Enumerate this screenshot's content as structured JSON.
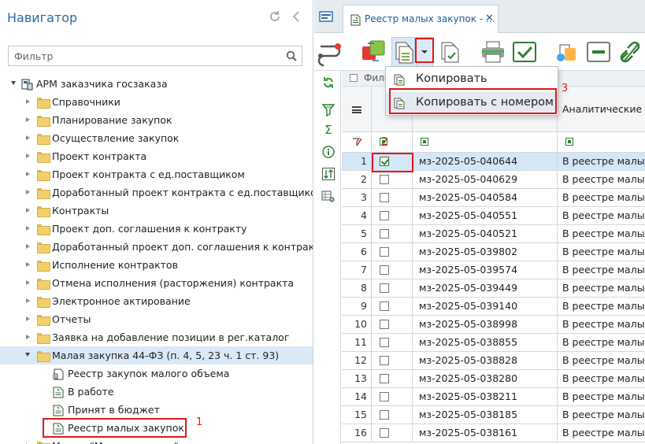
{
  "navigator": {
    "title": "Навигатор",
    "filter_placeholder": "Фильтр",
    "root": "АРМ заказчика госзаказа",
    "items": [
      "Справочники",
      "Планирование закупок",
      "Осуществление закупок",
      "Проект контракта",
      "Проект контракта с ед.поставщиком",
      "Доработанный проект контракта с ед.поставщиком",
      "Контракты",
      "Проект доп. соглашения к контракту",
      "Доработанный проект доп. соглашения к контрак...",
      "Исполнение контрактов",
      "Отмена исполнения (расторжения) контракта",
      "Электронное актирование",
      "Отчеты",
      "Заявка на добавление позиции в рег.каталог",
      "Малая закупка 44-ФЗ (п. 4, 5, 23 ч. 1 ст. 93)"
    ],
    "sub_items": [
      "Реестр закупок малого объема",
      "В работе",
      "Принят в бюджет",
      "Реестр малых закупок"
    ],
    "partial_next": "Малые \"Малые закупки\""
  },
  "tab": {
    "title": "Реестр малых закупок - ...",
    "close": "✕"
  },
  "filterbar": {
    "label": "Филь"
  },
  "menu": {
    "copy": "Копировать",
    "copy_with_number": "Копировать с номером"
  },
  "annotations": {
    "step1": "1",
    "step2": "2",
    "step3": "3"
  },
  "grid": {
    "header_text": "Аналитические пр",
    "header_partial": "р",
    "rows": [
      {
        "n": "1",
        "number": "мз-2025-05-040644",
        "analytic": "В реестре малых",
        "checked": true
      },
      {
        "n": "2",
        "number": "мз-2025-05-040629",
        "analytic": "В реестре малых",
        "checked": false
      },
      {
        "n": "3",
        "number": "мз-2025-05-040584",
        "analytic": "В реестре малых",
        "checked": false
      },
      {
        "n": "4",
        "number": "мз-2025-05-040551",
        "analytic": "В реестре малых",
        "checked": false
      },
      {
        "n": "5",
        "number": "мз-2025-05-040521",
        "analytic": "В реестре малых",
        "checked": false
      },
      {
        "n": "6",
        "number": "мз-2025-05-039802",
        "analytic": "В реестре малых",
        "checked": false
      },
      {
        "n": "7",
        "number": "мз-2025-05-039574",
        "analytic": "В реестре малых",
        "checked": false
      },
      {
        "n": "8",
        "number": "мз-2025-05-039449",
        "analytic": "В реестре малых",
        "checked": false
      },
      {
        "n": "9",
        "number": "мз-2025-05-039140",
        "analytic": "В реестре малых",
        "checked": false
      },
      {
        "n": "10",
        "number": "мз-2025-05-038998",
        "analytic": "В реестре малых",
        "checked": false
      },
      {
        "n": "11",
        "number": "мз-2025-05-038855",
        "analytic": "В реестре малых",
        "checked": false
      },
      {
        "n": "12",
        "number": "мз-2025-05-038828",
        "analytic": "В реестре малых",
        "checked": false
      },
      {
        "n": "13",
        "number": "мз-2025-05-038280",
        "analytic": "В реестре малых",
        "checked": false
      },
      {
        "n": "14",
        "number": "мз-2025-05-038211",
        "analytic": "В реестре малых",
        "checked": false
      },
      {
        "n": "15",
        "number": "мз-2025-05-038185",
        "analytic": "В реестре малых",
        "checked": false
      },
      {
        "n": "16",
        "number": "мз-2025-05-038161",
        "analytic": "В реестре малых",
        "checked": false
      }
    ]
  },
  "icons": {
    "refresh": "refresh-icon",
    "collapse": "chevron-left-icon",
    "search": "search-icon",
    "arm": "workstation-icon",
    "folder": "folder-icon",
    "doc": "document-icon"
  },
  "colors": {
    "accent": "#2c6aa0",
    "highlight": "#e01818",
    "selection": "#d5e6f7",
    "green": "#2e7d32"
  }
}
